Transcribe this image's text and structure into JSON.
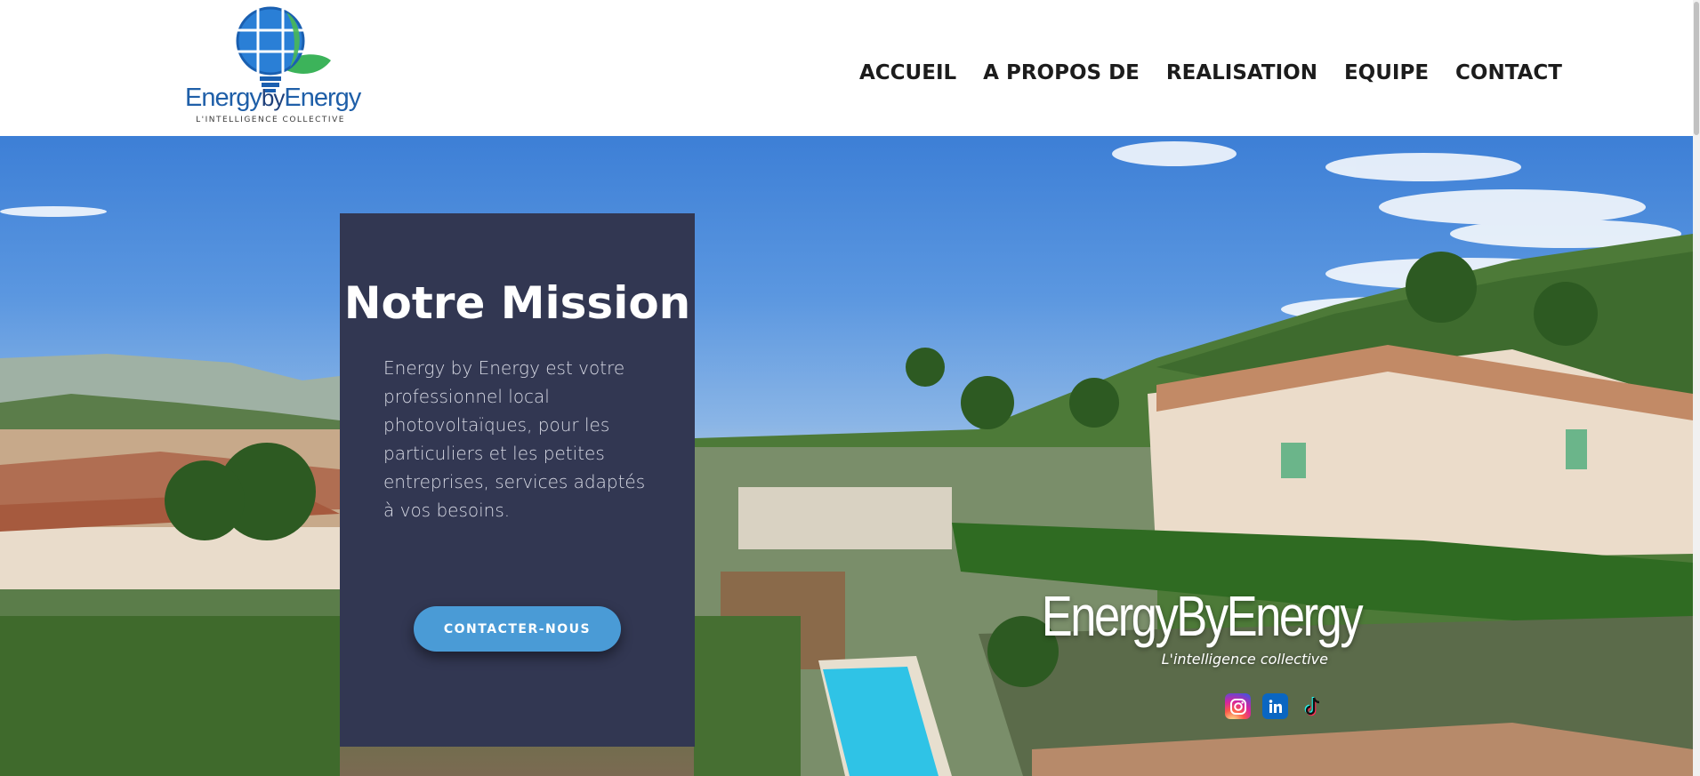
{
  "header": {
    "logo": {
      "word_part1": "Energy",
      "word_part2": "by",
      "word_part3": "Energy",
      "tagline": "L'INTELLIGENCE COLLECTIVE",
      "icon": "solar-bulb-leaf-icon"
    },
    "nav": [
      {
        "label": "ACCUEIL"
      },
      {
        "label": "A PROPOS DE"
      },
      {
        "label": "REALISATION"
      },
      {
        "label": "EQUIPE"
      },
      {
        "label": "CONTACT"
      }
    ]
  },
  "hero": {
    "mission": {
      "title": "Notre Mission",
      "text": "Energy by Energy est votre professionnel local photovoltaïques, pour les particuliers et les petites entreprises, services adaptés à vos besoins.",
      "button_label": "CONTACTER-NOUS"
    },
    "brand": {
      "name": "EnergyByEnergy",
      "tagline": "L'intelligence collective"
    },
    "socials": [
      {
        "name": "instagram-icon"
      },
      {
        "name": "linkedin-icon"
      },
      {
        "name": "tiktok-icon"
      }
    ]
  },
  "colors": {
    "card_bg": "#323752",
    "button_bg": "#4a9bd6",
    "logo_blue": "#1f5fa8",
    "leaf_green": "#3cb35a"
  }
}
